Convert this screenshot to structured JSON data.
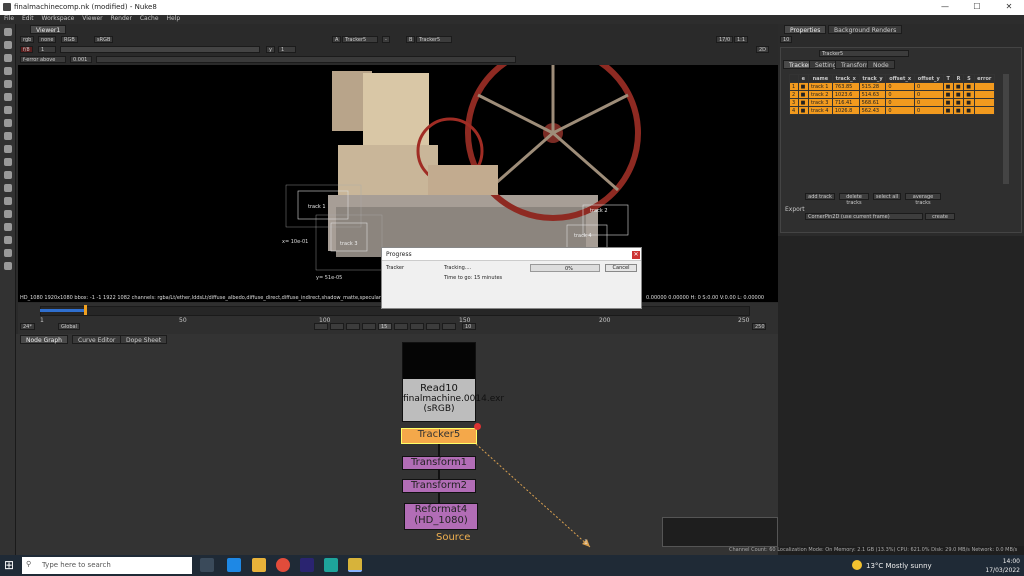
{
  "window": {
    "title": "finalmachinecomp.nk (modified) - Nuke8",
    "min": "—",
    "max": "☐",
    "close": "✕"
  },
  "menu": [
    "File",
    "Edit",
    "Workspace",
    "Viewer",
    "Render",
    "Cache",
    "Help"
  ],
  "viewer": {
    "tab": "Viewer1",
    "row1": {
      "layer": "rgb",
      "alpha": "none",
      "channels": "RGB",
      "lut": "sRGB",
      "a_input": "A",
      "a_node": "Tracker5",
      "ab_sep": "-",
      "b_input": "B",
      "b_node": "Tracker5",
      "frame": "17/0",
      "zoom": "1:1",
      "mode": "2D"
    },
    "row2": {
      "gain": "f/8",
      "gain_val": "1",
      "gamma": "y",
      "gamma_val": "1"
    },
    "row3": {
      "proxy": "f-error above",
      "proxy_val": "0.001"
    },
    "status": "HD_1080 1920x1080  bbox: -1 -1 1922 1082 channels: rgba/Lt/ether,lddsLt/diffuse_albedo,diffuse_direct,diffuse_indirect,shadow_matte,specular_direct...",
    "status_right": "0.00000  0.00000    H: 0 S:0.00 V:0.00   L: 0.00000",
    "track_labels": [
      "track 1",
      "track 2",
      "track 3",
      "track 4"
    ],
    "coords": [
      "x= 10e-01",
      "y= 51e-05"
    ]
  },
  "timeline": {
    "ticks": [
      "1",
      "50",
      "100",
      "150",
      "200",
      "250"
    ],
    "fps": "24*",
    "scope": "Global",
    "frame": "15",
    "inc": "10",
    "end": "250"
  },
  "progress": {
    "title": "Progress",
    "task": "Tracker",
    "status": "Tracking....",
    "time": "Time to go: 15 minutes",
    "pct": "0%",
    "pct_value": 0,
    "cancel": "Cancel"
  },
  "nodegraph": {
    "tabs": [
      "Node Graph",
      "Curve Editor",
      "Dope Sheet"
    ],
    "read": {
      "name": "Read10",
      "file": "finalmachine.0014.exr",
      "cs": "(sRGB)"
    },
    "tracker": "Tracker5",
    "t1": "Transform1",
    "t2": "Transform2",
    "reformat": {
      "name": "Reformat4",
      "fmt": "(HD_1080)"
    },
    "source": "Source",
    "arrow_label": "1"
  },
  "props": {
    "tabs": [
      "Properties",
      "Background Renders"
    ],
    "count": "10",
    "node": "Tracker5",
    "subtabs": [
      "Tracker",
      "Settings",
      "Transform",
      "Node"
    ],
    "cols": [
      "e",
      "name",
      "track_x",
      "track_y",
      "offset_x",
      "offset_y",
      "T",
      "R",
      "S",
      "error"
    ],
    "rows": [
      {
        "n": "1",
        "name": "track 1",
        "x": "763.85",
        "y": "515.28",
        "ox": "0",
        "oy": "0"
      },
      {
        "n": "2",
        "name": "track 2",
        "x": "1023.6",
        "y": "514.63",
        "ox": "0",
        "oy": "0"
      },
      {
        "n": "3",
        "name": "track 3",
        "x": "716.41",
        "y": "568.61",
        "ox": "0",
        "oy": "0"
      },
      {
        "n": "4",
        "name": "track 4",
        "x": "1026.8",
        "y": "562.43",
        "ox": "0",
        "oy": "0"
      }
    ],
    "buttons": [
      "add track",
      "delete tracks",
      "select all",
      "average tracks"
    ],
    "export": "Export",
    "export_mode": "CornerPin2D (use current frame)",
    "create": "create"
  },
  "statusbar": "Channel Count: 60  Localization Mode: On  Memory: 2.1 GB (13.3%)  CPU: 621.0%  Disk: 29.0 MB/s  Network: 0.0 MB/s",
  "taskbar": {
    "search": "Type here to search",
    "weather": "13°C  Mostly sunny",
    "time": "14:00",
    "date": "17/03/2022"
  },
  "colors": {
    "orange": "#f29a1e",
    "accent_red": "#c0392b"
  }
}
